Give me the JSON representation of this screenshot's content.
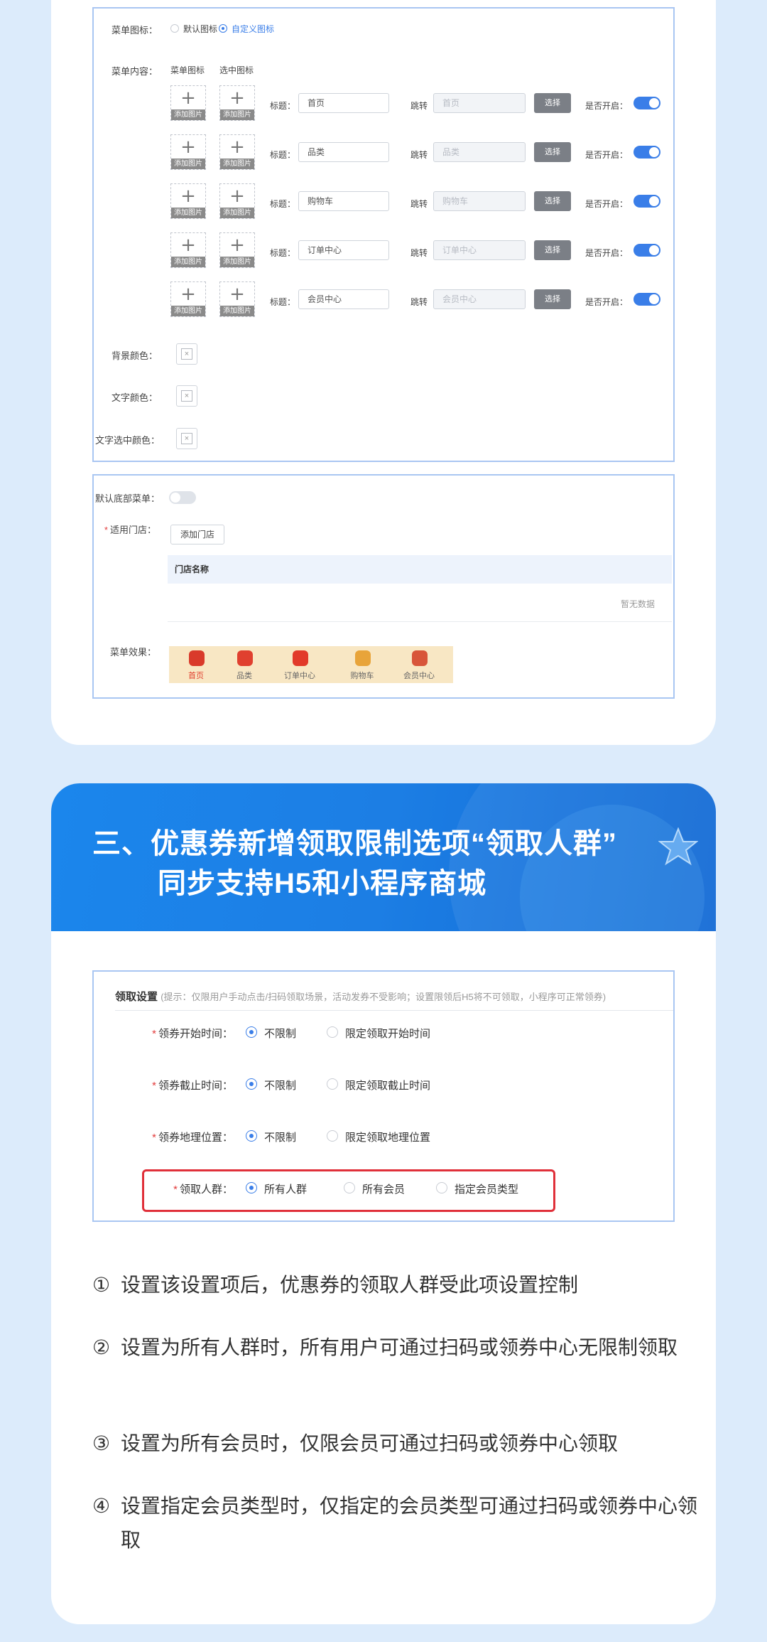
{
  "menu_config": {
    "icon_label": "菜单图标：",
    "icon_options": [
      "默认图标",
      "自定义图标"
    ],
    "content_label": "菜单内容：",
    "col_menu_icon": "菜单图标",
    "col_selected_icon": "选中图标",
    "upload_caption": "添加图片",
    "title_label": "标题：",
    "jump_label": "跳转",
    "choose_label": "选择",
    "enable_label": "是否开启：",
    "rows": [
      {
        "title": "首页",
        "jump": "首页",
        "enabled": true
      },
      {
        "title": "品类",
        "jump": "品类",
        "enabled": true
      },
      {
        "title": "购物车",
        "jump": "购物车",
        "enabled": true
      },
      {
        "title": "订单中心",
        "jump": "订单中心",
        "enabled": true
      },
      {
        "title": "会员中心",
        "jump": "会员中心",
        "enabled": true
      }
    ],
    "bg_color_label": "背景颜色：",
    "text_color_label": "文字颜色：",
    "text_selected_color_label": "文字选中颜色：",
    "swatch_mark": "×"
  },
  "footer_config": {
    "default_menu_label": "默认底部菜单：",
    "default_menu_enabled": false,
    "store_label": "适用门店：",
    "add_store_button": "添加门店",
    "table_header": "门店名称",
    "empty_text": "暂无数据",
    "effect_label": "菜单效果：",
    "preview_items": [
      {
        "label": "首页",
        "color": "#d93a2b"
      },
      {
        "label": "品类",
        "color": "#e0402f"
      },
      {
        "label": "订单中心",
        "color": "#e23a2a"
      },
      {
        "label": "购物车",
        "color": "#e8a43a"
      },
      {
        "label": "会员中心",
        "color": "#d8553a"
      }
    ],
    "preview_active_color": "#e0402f"
  },
  "banner": {
    "line1": "三、优惠券新增领取限制选项“领取人群”",
    "line2": "同步支持H5和小程序商城"
  },
  "coupon_settings": {
    "section_title": "领取设置",
    "hint": "(提示：仅限用户手动点击/扫码领取场景，活动发券不受影响；设置限领后H5将不可领取，小程序可正常领券)",
    "rows": [
      {
        "label": "领券开始时间：",
        "options": [
          "不限制",
          "限定领取开始时间"
        ]
      },
      {
        "label": "领券截止时间：",
        "options": [
          "不限制",
          "限定领取截止时间"
        ]
      },
      {
        "label": "领券地理位置：",
        "options": [
          "不限制",
          "限定领取地理位置"
        ]
      },
      {
        "label": "领取人群：",
        "options": [
          "所有人群",
          "所有会员",
          "指定会员类型"
        ]
      }
    ]
  },
  "notes": [
    {
      "num": "①",
      "text": "设置该设置项后，优惠券的领取人群受此项设置控制"
    },
    {
      "num": "②",
      "text": "设置为所有人群时，所有用户可通过扫码或领券中心无限制领取"
    },
    {
      "num": "③",
      "text": "设置为所有会员时，仅限会员可通过扫码或领券中心领取"
    },
    {
      "num": "④",
      "text": "设置指定会员类型时，仅指定的会员类型可通过扫码或领券中心领取"
    }
  ],
  "colors": {
    "accent": "#3a7ee8",
    "highlight_border": "#e0303a",
    "page_background": "#dcebfb"
  }
}
